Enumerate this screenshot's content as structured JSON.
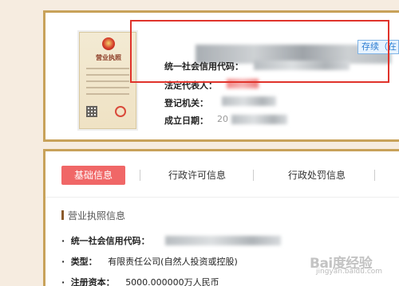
{
  "company": {
    "status": "存续（在",
    "fields": [
      {
        "label": "统一社会信用代码："
      },
      {
        "label": "法定代表人："
      },
      {
        "label": "登记机关："
      },
      {
        "label": "成立日期：",
        "value_prefix": "20"
      }
    ]
  },
  "license_thumbnail": {
    "title": "营业执照"
  },
  "tabs": [
    {
      "label": "基础信息",
      "active": true
    },
    {
      "label": "行政许可信息",
      "active": false
    },
    {
      "label": "行政处罚信息",
      "active": false
    }
  ],
  "section": {
    "title": "营业执照信息",
    "rows": [
      {
        "label": "统一社会信用代码：",
        "value": ""
      },
      {
        "label": "类型：",
        "value": "有限责任公司(自然人投资或控股)"
      },
      {
        "label": "注册资本：",
        "value": "5000.000000万人民币"
      }
    ]
  },
  "watermark": {
    "brand": "Bai度经验",
    "sub": "jingyan.baidu.com"
  },
  "colors": {
    "card_border": "#c8a25a",
    "active_tab": "#f06767",
    "highlight": "#e0332b",
    "status_badge": "#2a7bd0"
  }
}
